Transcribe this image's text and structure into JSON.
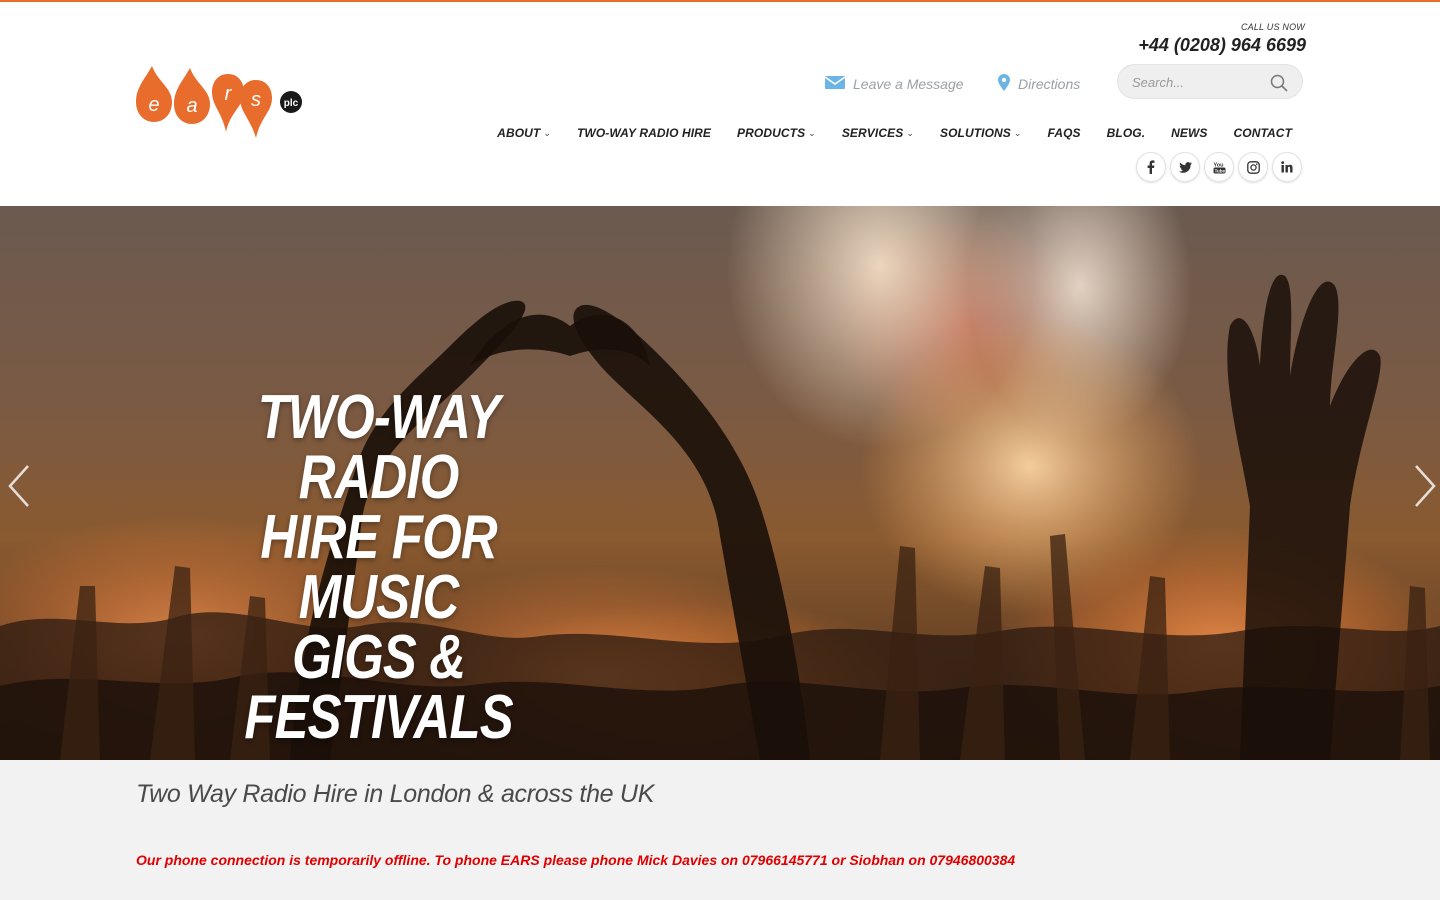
{
  "header": {
    "call_label": "CALL US NOW",
    "phone": "+44 (0208) 964 6699",
    "leave_message": "Leave a Message",
    "directions": "Directions",
    "search_placeholder": "Search...",
    "logo_text": "ears",
    "logo_suffix": "plc"
  },
  "nav": {
    "items": [
      {
        "label": "ABOUT",
        "has_dropdown": true
      },
      {
        "label": "TWO-WAY RADIO HIRE",
        "has_dropdown": false
      },
      {
        "label": "PRODUCTS",
        "has_dropdown": true
      },
      {
        "label": "SERVICES",
        "has_dropdown": true
      },
      {
        "label": "SOLUTIONS",
        "has_dropdown": true
      },
      {
        "label": "FAQS",
        "has_dropdown": false
      },
      {
        "label": "BLOG.",
        "has_dropdown": false
      },
      {
        "label": "NEWS",
        "has_dropdown": false
      },
      {
        "label": "CONTACT",
        "has_dropdown": false
      }
    ]
  },
  "social": {
    "icons": [
      "facebook-icon",
      "twitter-icon",
      "youtube-icon",
      "instagram-icon",
      "linkedin-icon"
    ]
  },
  "hero": {
    "title_line1": "TWO-WAY RADIO",
    "title_line2": "HIRE FOR MUSIC",
    "title_line3": "GIGS & FESTIVALS"
  },
  "intro": {
    "heading": "Two Way Radio Hire in London & across the UK",
    "notice": "Our phone connection is temporarily offline. To phone EARS please phone Mick Davies on 07966145771 or Siobhan on 07946800384"
  },
  "colors": {
    "brand_orange": "#e86c2c",
    "notice_red": "#e00000",
    "icon_blue": "#6ab4e6"
  }
}
